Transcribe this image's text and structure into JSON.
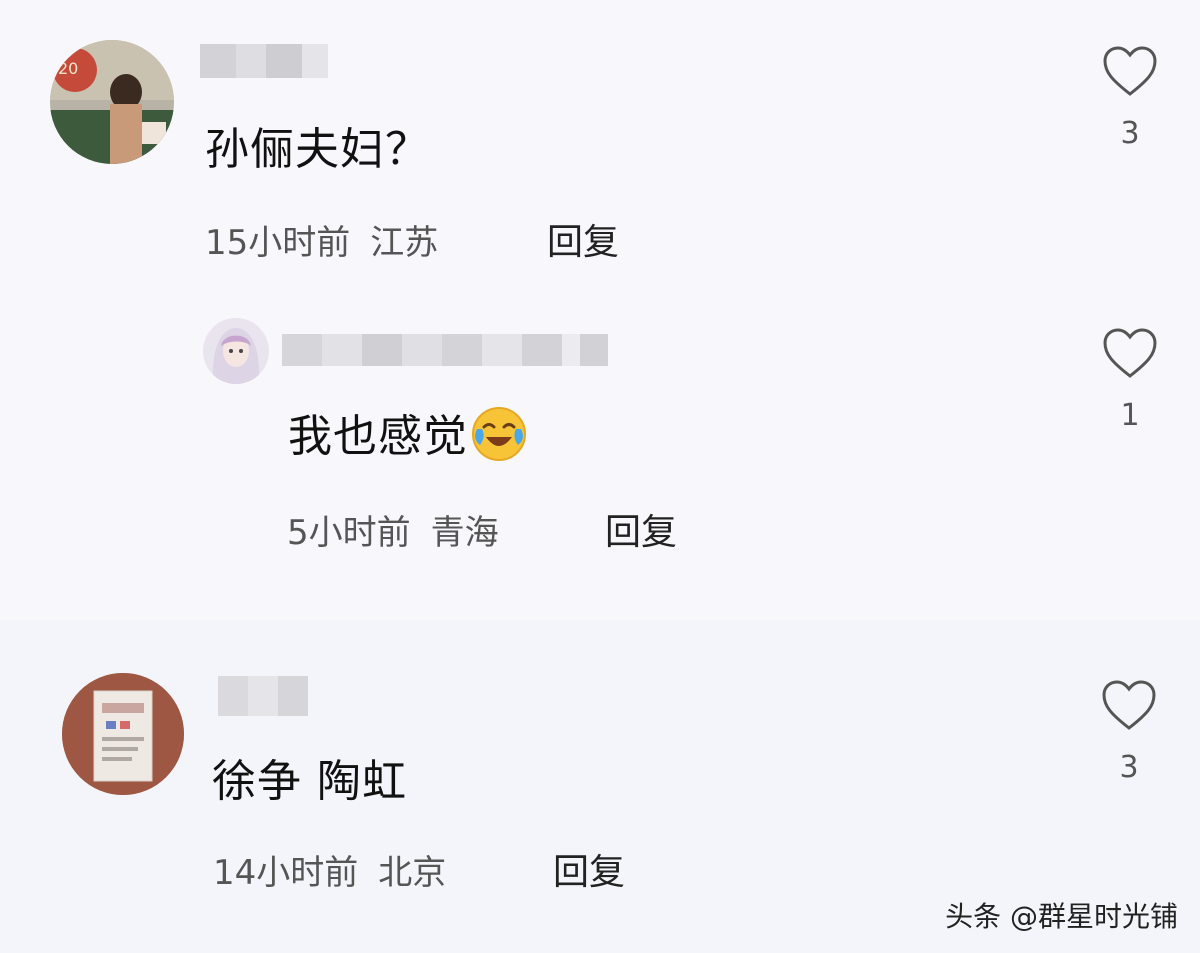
{
  "comments": [
    {
      "text": "孙俪夫妇？",
      "time": "15小时前",
      "location": "江苏",
      "reply_label": "回复",
      "likes": "3"
    },
    {
      "text": "我也感觉",
      "emoji": "laughing-crying-emoji",
      "time": "5小时前",
      "location": "青海",
      "reply_label": "回复",
      "likes": "1"
    },
    {
      "text": "徐争 陶虹",
      "time": "14小时前",
      "location": "北京",
      "reply_label": "回复",
      "likes": "3"
    }
  ],
  "watermark": "头条 @群星时光铺",
  "icons": {
    "like": "heart-outline-icon"
  },
  "colors": {
    "background": "#f7f7fb",
    "meta_text": "#555555",
    "heart_stroke": "#555555"
  }
}
